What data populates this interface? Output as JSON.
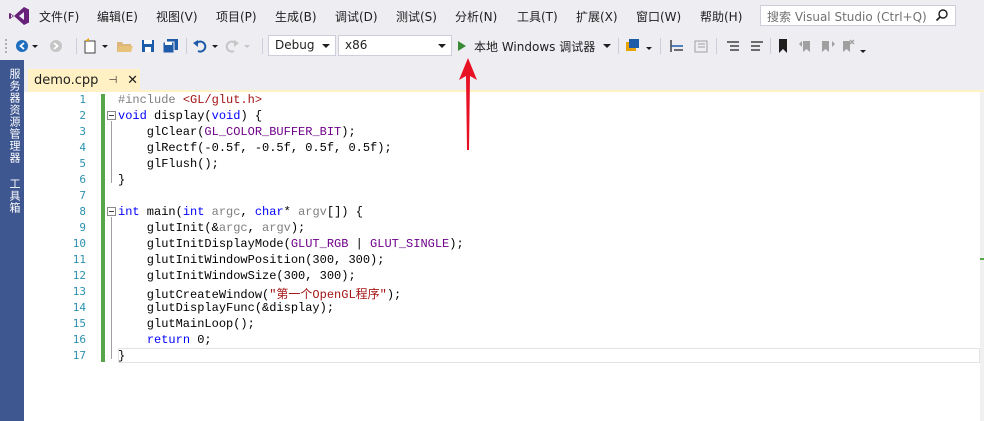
{
  "menu": {
    "items": [
      "文件(F)",
      "编辑(E)",
      "视图(V)",
      "项目(P)",
      "生成(B)",
      "调试(D)",
      "测试(S)",
      "分析(N)",
      "工具(T)",
      "扩展(X)",
      "窗口(W)",
      "帮助(H)"
    ],
    "search_placeholder": "搜索 Visual Studio (Ctrl+Q)"
  },
  "toolbar": {
    "config": "Debug",
    "platform": "x86",
    "run_label": "本地 Windows 调试器"
  },
  "sidebar": {
    "tabs": [
      "服务器资源管理器",
      "工具箱"
    ]
  },
  "tab": {
    "name": "demo.cpp",
    "pin": "⊣",
    "close": "✕"
  },
  "editor": {
    "line_numbers": [
      "1",
      "2",
      "3",
      "4",
      "5",
      "6",
      "7",
      "8",
      "9",
      "10",
      "11",
      "12",
      "13",
      "14",
      "15",
      "16",
      "17"
    ],
    "lines": [
      [
        {
          "t": "#include ",
          "c": "pp"
        },
        {
          "t": "<GL/glut.h>",
          "c": "str"
        }
      ],
      [
        {
          "t": "void",
          "c": "kw"
        },
        {
          "t": " display(",
          "c": ""
        },
        {
          "t": "void",
          "c": "kw"
        },
        {
          "t": ") {",
          "c": ""
        }
      ],
      [
        {
          "t": "    glClear(",
          "c": ""
        },
        {
          "t": "GL_COLOR_BUFFER_BIT",
          "c": "mac"
        },
        {
          "t": ");",
          "c": ""
        }
      ],
      [
        {
          "t": "    glRectf(-0.5f, -0.5f, 0.5f, 0.5f);",
          "c": ""
        }
      ],
      [
        {
          "t": "    glFlush();",
          "c": ""
        }
      ],
      [
        {
          "t": "}",
          "c": ""
        }
      ],
      [],
      [
        {
          "t": "int",
          "c": "kw"
        },
        {
          "t": " main(",
          "c": ""
        },
        {
          "t": "int",
          "c": "kw"
        },
        {
          "t": " ",
          "c": ""
        },
        {
          "t": "argc",
          "c": "prm"
        },
        {
          "t": ", ",
          "c": ""
        },
        {
          "t": "char",
          "c": "kw"
        },
        {
          "t": "* ",
          "c": ""
        },
        {
          "t": "argv",
          "c": "prm"
        },
        {
          "t": "[]) {",
          "c": ""
        }
      ],
      [
        {
          "t": "    glutInit(&",
          "c": ""
        },
        {
          "t": "argc",
          "c": "prm"
        },
        {
          "t": ", ",
          "c": ""
        },
        {
          "t": "argv",
          "c": "prm"
        },
        {
          "t": ");",
          "c": ""
        }
      ],
      [
        {
          "t": "    glutInitDisplayMode(",
          "c": ""
        },
        {
          "t": "GLUT_RGB",
          "c": "mac"
        },
        {
          "t": " | ",
          "c": ""
        },
        {
          "t": "GLUT_SINGLE",
          "c": "mac"
        },
        {
          "t": ");",
          "c": ""
        }
      ],
      [
        {
          "t": "    glutInitWindowPosition(300, 300);",
          "c": ""
        }
      ],
      [
        {
          "t": "    glutInitWindowSize(300, 300);",
          "c": ""
        }
      ],
      [
        {
          "t": "    glutCreateWindow(",
          "c": ""
        },
        {
          "t": "\"第一个OpenGL程序\"",
          "c": "str"
        },
        {
          "t": ");",
          "c": ""
        }
      ],
      [
        {
          "t": "    glutDisplayFunc(&display);",
          "c": ""
        }
      ],
      [
        {
          "t": "    glutMainLoop();",
          "c": ""
        }
      ],
      [
        {
          "t": "    ",
          "c": ""
        },
        {
          "t": "return",
          "c": "kw"
        },
        {
          "t": " 0;",
          "c": ""
        }
      ],
      [
        {
          "t": "}",
          "c": ""
        }
      ]
    ]
  },
  "colors": {
    "accent": "#68217a",
    "sidebar": "#3f5790",
    "tab_active": "#fff1c4",
    "change_bar": "#57a64a",
    "annotation_arrow": "#e81123"
  }
}
